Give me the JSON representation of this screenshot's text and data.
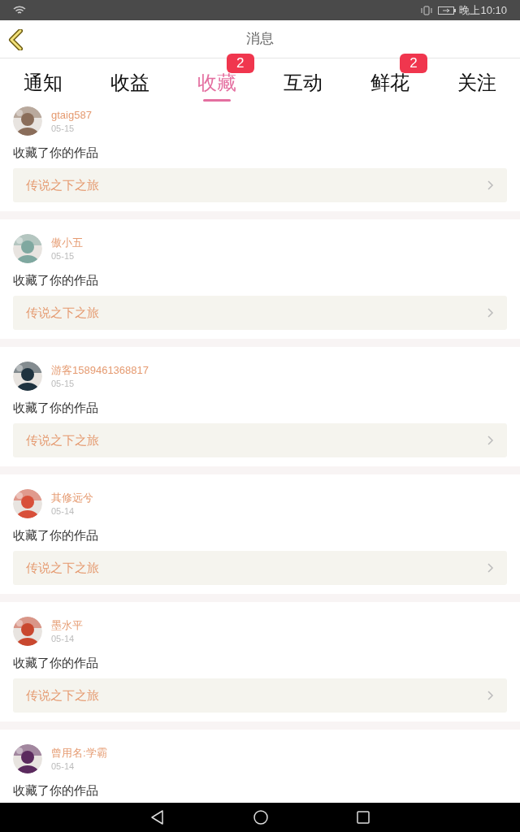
{
  "status_bar": {
    "time": "晚上10:10"
  },
  "header": {
    "title": "消息"
  },
  "tabs": [
    {
      "label": "通知",
      "selected": false
    },
    {
      "label": "收益",
      "selected": false
    },
    {
      "label": "收藏",
      "selected": true,
      "badge": "2"
    },
    {
      "label": "互动",
      "selected": false
    },
    {
      "label": "鲜花",
      "selected": false,
      "badge": "2"
    },
    {
      "label": "关注",
      "selected": false
    }
  ],
  "messages": [
    {
      "user": "gtaig587",
      "date": "05-15",
      "action": "收藏了你的作品",
      "work": "传说之下之旅"
    },
    {
      "user": "傲小五",
      "date": "05-15",
      "action": "收藏了你的作品",
      "work": "传说之下之旅"
    },
    {
      "user": "游客1589461368817",
      "date": "05-15",
      "action": "收藏了你的作品",
      "work": "传说之下之旅"
    },
    {
      "user": "其修远兮",
      "date": "05-14",
      "action": "收藏了你的作品",
      "work": "传说之下之旅"
    },
    {
      "user": "墨水平",
      "date": "05-14",
      "action": "收藏了你的作品",
      "work": "传说之下之旅"
    },
    {
      "user": "曾用名:学霸",
      "date": "05-14",
      "action": "收藏了你的作品"
    }
  ]
}
